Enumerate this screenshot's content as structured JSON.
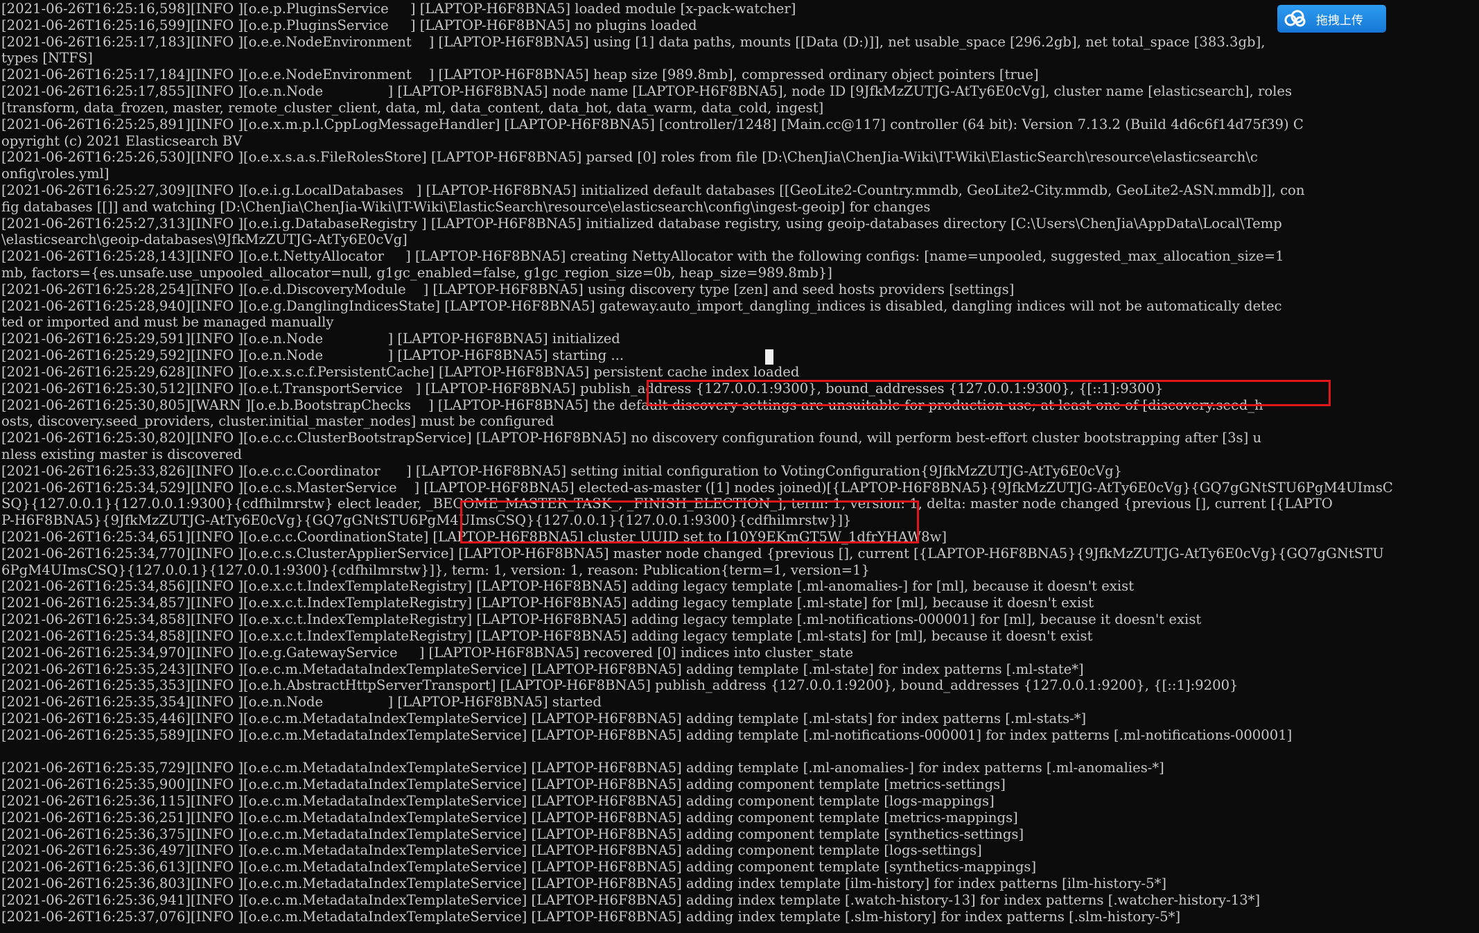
{
  "colors": {
    "background": "#0c0c0c",
    "text": "#c8c8c8",
    "highlight_box": "#e0161b",
    "upload_button": "#1e88e5"
  },
  "upload_button": {
    "label": "拖拽上传",
    "icon": "cloud-upload-icon"
  },
  "log_lines": [
    "[2021-06-26T16:25:16,598][INFO ][o.e.p.PluginsService     ] [LAPTOP-H6F8BNA5] loaded module [x-pack-watcher]",
    "[2021-06-26T16:25:16,599][INFO ][o.e.p.PluginsService     ] [LAPTOP-H6F8BNA5] no plugins loaded",
    "[2021-06-26T16:25:17,183][INFO ][o.e.e.NodeEnvironment    ] [LAPTOP-H6F8BNA5] using [1] data paths, mounts [[Data (D:)]], net usable_space [296.2gb], net total_space [383.3gb],",
    "types [NTFS]",
    "[2021-06-26T16:25:17,184][INFO ][o.e.e.NodeEnvironment    ] [LAPTOP-H6F8BNA5] heap size [989.8mb], compressed ordinary object pointers [true]",
    "[2021-06-26T16:25:17,855][INFO ][o.e.n.Node               ] [LAPTOP-H6F8BNA5] node name [LAPTOP-H6F8BNA5], node ID [9JfkMzZUTJG-AtTy6E0cVg], cluster name [elasticsearch], roles",
    "[transform, data_frozen, master, remote_cluster_client, data, ml, data_content, data_hot, data_warm, data_cold, ingest]",
    "[2021-06-26T16:25:25,891][INFO ][o.e.x.m.p.l.CppLogMessageHandler] [LAPTOP-H6F8BNA5] [controller/1248] [Main.cc@117] controller (64 bit): Version 7.13.2 (Build 4d6c6f14d75f39) C",
    "opyright (c) 2021 Elasticsearch BV",
    "[2021-06-26T16:25:26,530][INFO ][o.e.x.s.a.s.FileRolesStore] [LAPTOP-H6F8BNA5] parsed [0] roles from file [D:\\ChenJia\\ChenJia-Wiki\\IT-Wiki\\ElasticSearch\\resource\\elasticsearch\\c",
    "onfig\\roles.yml]",
    "[2021-06-26T16:25:27,309][INFO ][o.e.i.g.LocalDatabases   ] [LAPTOP-H6F8BNA5] initialized default databases [[GeoLite2-Country.mmdb, GeoLite2-City.mmdb, GeoLite2-ASN.mmdb]], con",
    "fig databases [[]] and watching [D:\\ChenJia\\ChenJia-Wiki\\IT-Wiki\\ElasticSearch\\resource\\elasticsearch\\config\\ingest-geoip] for changes",
    "[2021-06-26T16:25:27,313][INFO ][o.e.i.g.DatabaseRegistry ] [LAPTOP-H6F8BNA5] initialized database registry, using geoip-databases directory [C:\\Users\\ChenJia\\AppData\\Local\\Temp",
    "\\elasticsearch\\geoip-databases\\9JfkMzZUTJG-AtTy6E0cVg]",
    "[2021-06-26T16:25:28,143][INFO ][o.e.t.NettyAllocator     ] [LAPTOP-H6F8BNA5] creating NettyAllocator with the following configs: [name=unpooled, suggested_max_allocation_size=1",
    "mb, factors={es.unsafe.use_unpooled_allocator=null, g1gc_enabled=false, g1gc_region_size=0b, heap_size=989.8mb}]",
    "[2021-06-26T16:25:28,254][INFO ][o.e.d.DiscoveryModule    ] [LAPTOP-H6F8BNA5] using discovery type [zen] and seed hosts providers [settings]",
    "[2021-06-26T16:25:28,940][INFO ][o.e.g.DanglingIndicesState] [LAPTOP-H6F8BNA5] gateway.auto_import_dangling_indices is disabled, dangling indices will not be automatically detec",
    "ted or imported and must be managed manually",
    "[2021-06-26T16:25:29,591][INFO ][o.e.n.Node               ] [LAPTOP-H6F8BNA5] initialized",
    "[2021-06-26T16:25:29,592][INFO ][o.e.n.Node               ] [LAPTOP-H6F8BNA5] starting ...",
    "[2021-06-26T16:25:29,628][INFO ][o.e.x.s.c.f.PersistentCache] [LAPTOP-H6F8BNA5] persistent cache index loaded",
    "[2021-06-26T16:25:30,512][INFO ][o.e.t.TransportService   ] [LAPTOP-H6F8BNA5] publish_address {127.0.0.1:9300}, bound_addresses {127.0.0.1:9300}, {[::1]:9300}",
    "[2021-06-26T16:25:30,805][WARN ][o.e.b.BootstrapChecks    ] [LAPTOP-H6F8BNA5] the default discovery settings are unsuitable for production use; at least one of [discovery.seed_h",
    "osts, discovery.seed_providers, cluster.initial_master_nodes] must be configured",
    "[2021-06-26T16:25:30,820][INFO ][o.e.c.c.ClusterBootstrapService] [LAPTOP-H6F8BNA5] no discovery configuration found, will perform best-effort cluster bootstrapping after [3s] u",
    "nless existing master is discovered",
    "[2021-06-26T16:25:33,826][INFO ][o.e.c.c.Coordinator      ] [LAPTOP-H6F8BNA5] setting initial configuration to VotingConfiguration{9JfkMzZUTJG-AtTy6E0cVg}",
    "[2021-06-26T16:25:34,529][INFO ][o.e.c.s.MasterService    ] [LAPTOP-H6F8BNA5] elected-as-master ([1] nodes joined)[{LAPTOP-H6F8BNA5}{9JfkMzZUTJG-AtTy6E0cVg}{GQ7gGNtSTU6PgM4UImsC",
    "SQ}{127.0.0.1}{127.0.0.1:9300}{cdfhilmrstw} elect leader, _BECOME_MASTER_TASK_, _FINISH_ELECTION_], term: 1, version: 1, delta: master node changed {previous [], current [{LAPTO",
    "P-H6F8BNA5}{9JfkMzZUTJG-AtTy6E0cVg}{GQ7gGNtSTU6PgM4UImsCSQ}{127.0.0.1}{127.0.0.1:9300}{cdfhilmrstw}]}",
    "[2021-06-26T16:25:34,651][INFO ][o.e.c.c.CoordinationState] [LAPTOP-H6F8BNA5] cluster UUID set to [10Y9EKmGT5W_1dfrYHAW8w]",
    "[2021-06-26T16:25:34,770][INFO ][o.e.c.s.ClusterApplierService] [LAPTOP-H6F8BNA5] master node changed {previous [], current [{LAPTOP-H6F8BNA5}{9JfkMzZUTJG-AtTy6E0cVg}{GQ7gGNtSTU",
    "6PgM4UImsCSQ}{127.0.0.1}{127.0.0.1:9300}{cdfhilmrstw}]}, term: 1, version: 1, reason: Publication{term=1, version=1}",
    "[2021-06-26T16:25:34,856][INFO ][o.e.x.c.t.IndexTemplateRegistry] [LAPTOP-H6F8BNA5] adding legacy template [.ml-anomalies-] for [ml], because it doesn't exist",
    "[2021-06-26T16:25:34,857][INFO ][o.e.x.c.t.IndexTemplateRegistry] [LAPTOP-H6F8BNA5] adding legacy template [.ml-state] for [ml], because it doesn't exist",
    "[2021-06-26T16:25:34,858][INFO ][o.e.x.c.t.IndexTemplateRegistry] [LAPTOP-H6F8BNA5] adding legacy template [.ml-notifications-000001] for [ml], because it doesn't exist",
    "[2021-06-26T16:25:34,858][INFO ][o.e.x.c.t.IndexTemplateRegistry] [LAPTOP-H6F8BNA5] adding legacy template [.ml-stats] for [ml], because it doesn't exist",
    "[2021-06-26T16:25:34,970][INFO ][o.e.g.GatewayService     ] [LAPTOP-H6F8BNA5] recovered [0] indices into cluster_state",
    "[2021-06-26T16:25:35,243][INFO ][o.e.c.m.MetadataIndexTemplateService] [LAPTOP-H6F8BNA5] adding template [.ml-state] for index patterns [.ml-state*]",
    "[2021-06-26T16:25:35,353][INFO ][o.e.h.AbstractHttpServerTransport] [LAPTOP-H6F8BNA5] publish_address {127.0.0.1:9200}, bound_addresses {127.0.0.1:9200}, {[::1]:9200}",
    "[2021-06-26T16:25:35,354][INFO ][o.e.n.Node               ] [LAPTOP-H6F8BNA5] started",
    "[2021-06-26T16:25:35,446][INFO ][o.e.c.m.MetadataIndexTemplateService] [LAPTOP-H6F8BNA5] adding template [.ml-stats] for index patterns [.ml-stats-*]",
    "[2021-06-26T16:25:35,589][INFO ][o.e.c.m.MetadataIndexTemplateService] [LAPTOP-H6F8BNA5] adding template [.ml-notifications-000001] for index patterns [.ml-notifications-000001]",
    "",
    "[2021-06-26T16:25:35,729][INFO ][o.e.c.m.MetadataIndexTemplateService] [LAPTOP-H6F8BNA5] adding template [.ml-anomalies-] for index patterns [.ml-anomalies-*]",
    "[2021-06-26T16:25:35,900][INFO ][o.e.c.m.MetadataIndexTemplateService] [LAPTOP-H6F8BNA5] adding component template [metrics-settings]",
    "[2021-06-26T16:25:36,115][INFO ][o.e.c.m.MetadataIndexTemplateService] [LAPTOP-H6F8BNA5] adding component template [logs-mappings]",
    "[2021-06-26T16:25:36,251][INFO ][o.e.c.m.MetadataIndexTemplateService] [LAPTOP-H6F8BNA5] adding component template [metrics-mappings]",
    "[2021-06-26T16:25:36,375][INFO ][o.e.c.m.MetadataIndexTemplateService] [LAPTOP-H6F8BNA5] adding component template [synthetics-settings]",
    "[2021-06-26T16:25:36,497][INFO ][o.e.c.m.MetadataIndexTemplateService] [LAPTOP-H6F8BNA5] adding component template [logs-settings]",
    "[2021-06-26T16:25:36,613][INFO ][o.e.c.m.MetadataIndexTemplateService] [LAPTOP-H6F8BNA5] adding component template [synthetics-mappings]",
    "[2021-06-26T16:25:36,803][INFO ][o.e.c.m.MetadataIndexTemplateService] [LAPTOP-H6F8BNA5] adding index template [ilm-history] for index patterns [ilm-history-5*]",
    "[2021-06-26T16:25:36,941][INFO ][o.e.c.m.MetadataIndexTemplateService] [LAPTOP-H6F8BNA5] adding index template [.watch-history-13] for index patterns [.watcher-history-13*]",
    "[2021-06-26T16:25:37,076][INFO ][o.e.c.m.MetadataIndexTemplateService] [LAPTOP-H6F8BNA5] adding index template [.slm-history] for index patterns [.slm-history-5*]"
  ]
}
